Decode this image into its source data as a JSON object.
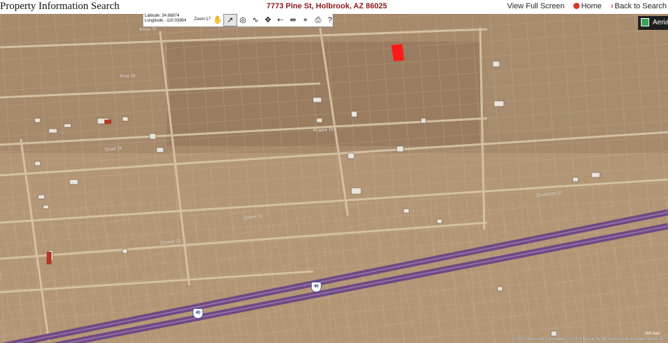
{
  "header": {
    "app_title": "Property Information Search",
    "address": "7773 Pine St, Holbrook, AZ 86025",
    "nav": {
      "full_screen": "View Full Screen",
      "home": "Home",
      "back": "Back to Search"
    }
  },
  "toolbar": {
    "latitude": "Latitude: 34.98874",
    "longitude": "Longitude: -110.03854",
    "zoom": "Zoom:17",
    "tools": [
      {
        "name": "pan-hand-icon",
        "glyph": "✋"
      },
      {
        "name": "select-pointer-icon",
        "glyph": "➚"
      },
      {
        "name": "zoom-to-parcel-icon",
        "glyph": "◎"
      },
      {
        "name": "measure-icon",
        "glyph": "∿"
      },
      {
        "name": "pan-arrows-icon",
        "glyph": "✥"
      },
      {
        "name": "back-arrow-icon",
        "glyph": "⇠"
      },
      {
        "name": "measure-distance-icon",
        "glyph": "⇹"
      },
      {
        "name": "identify-icon",
        "glyph": "⌖"
      },
      {
        "name": "print-icon",
        "glyph": "⎙"
      },
      {
        "name": "help-icon",
        "glyph": "?"
      }
    ]
  },
  "map": {
    "basemap_toggle": "Aerial",
    "streets": {
      "pima": "Pima St",
      "pine": "Pine St",
      "prairie": "Prairie St",
      "quail": "Quail St",
      "quartzite": "Quartzite St",
      "quartz": "Quartz St",
      "quest": "Quest St",
      "i40": "40"
    },
    "copyright": "© 2023 Microsoft Corporation © 2023 Maxar ©CNES (2023) Distribution Airbus DS",
    "scale": "200 feet",
    "colors": {
      "selected_parcel": "#ff1a1a",
      "highway": "#7a4f8e",
      "terrain": "#b49774"
    }
  }
}
